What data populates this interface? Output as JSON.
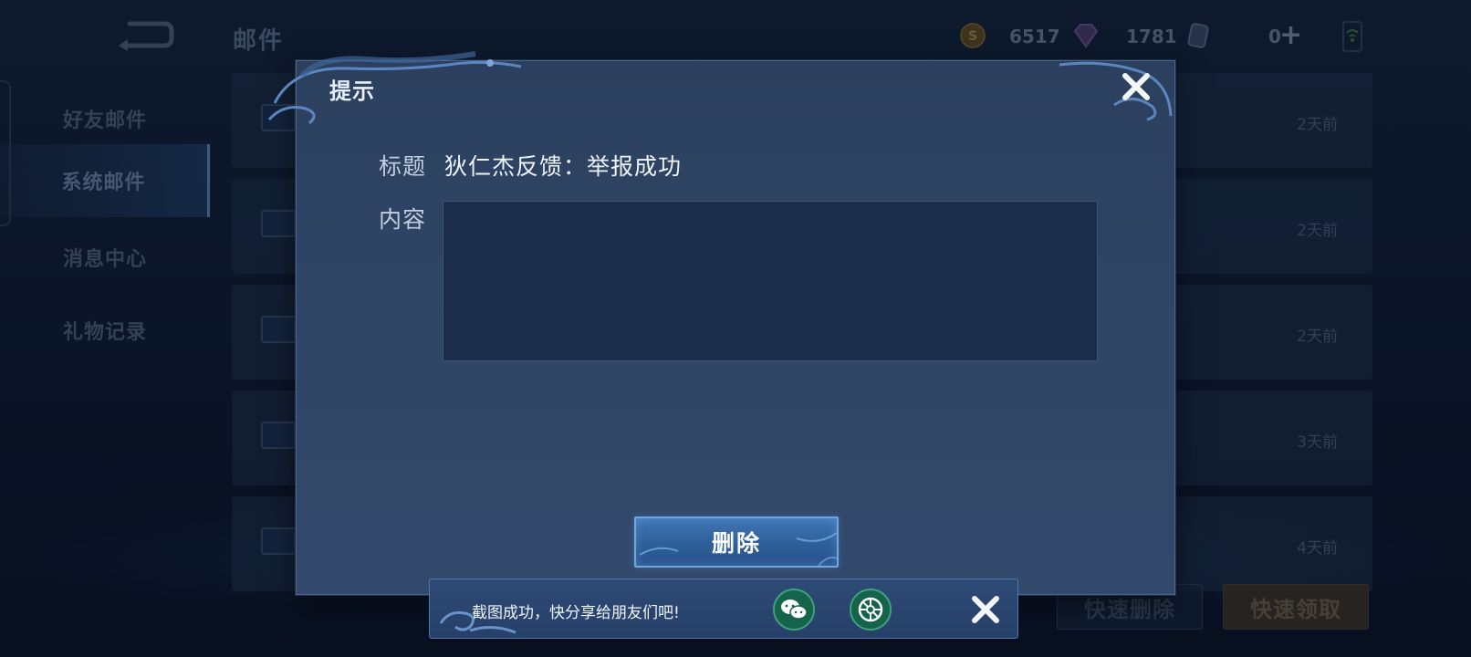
{
  "header": {
    "title": "邮件",
    "gold_amount": "6517",
    "gem_amount": "1781",
    "coupon_amount": "0"
  },
  "sidebar": {
    "items": [
      {
        "label": "好友邮件"
      },
      {
        "label": "系统邮件"
      },
      {
        "label": "消息中心"
      },
      {
        "label": "礼物记录"
      }
    ],
    "active_index": 1
  },
  "mail_list": {
    "rows": [
      {
        "time": "2天前"
      },
      {
        "time": "2天前"
      },
      {
        "time": "2天前"
      },
      {
        "time": "3天前"
      },
      {
        "time": "4天前"
      }
    ]
  },
  "actions": {
    "quick_delete": "快速删除",
    "quick_collect": "快速领取"
  },
  "dialog": {
    "title": "提示",
    "subject_label": "标题",
    "subject_value": "狄仁杰反馈：举报成功",
    "content_label": "内容",
    "content_value": "",
    "delete_button": "删除"
  },
  "toast": {
    "message": "截图成功，快分享给朋友们吧!"
  },
  "colors": {
    "accent": "#3f76b4",
    "dialog_bg": "#2f4565",
    "share_green": "#14634a"
  },
  "icons": {
    "back": "back-arrow-icon",
    "gold": "gold-coin-icon",
    "gem": "gem-icon",
    "coupon": "coupon-icon",
    "wifi": "wifi-signal-icon",
    "mail": "mail-envelope-icon",
    "close": "close-icon",
    "wechat": "wechat-icon",
    "moments": "moments-icon"
  }
}
